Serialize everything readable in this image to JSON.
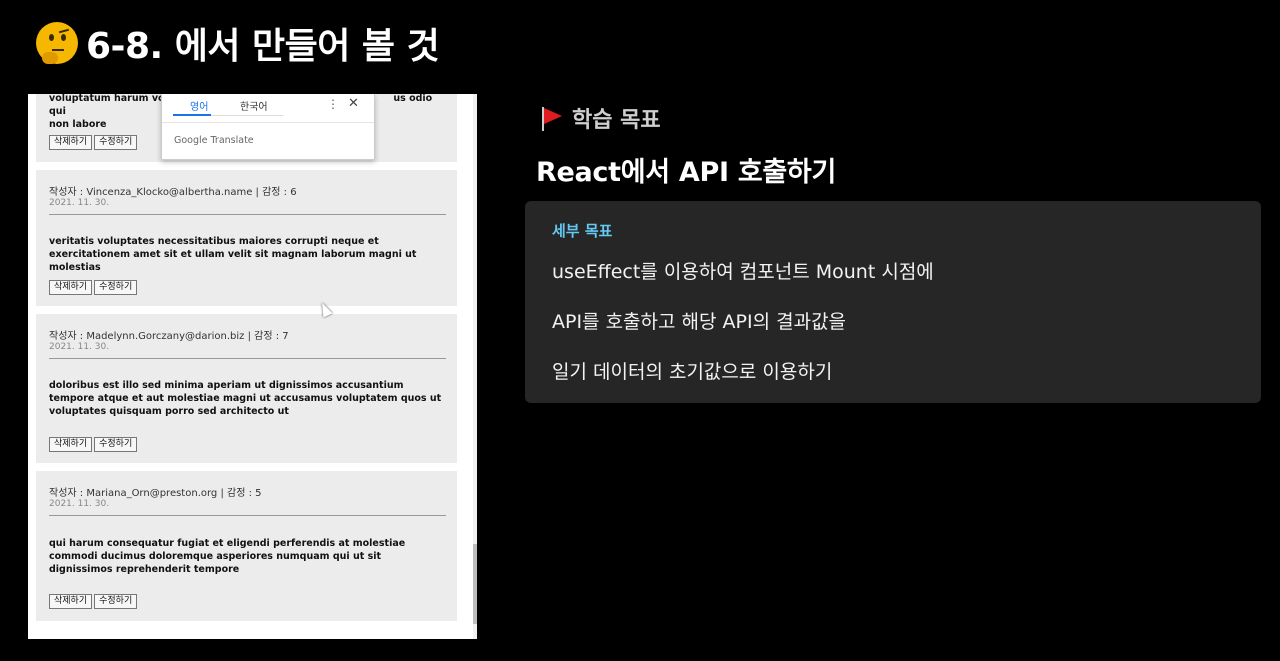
{
  "slide": {
    "title": "6-8. 에서 만들어 볼 것",
    "title_icon": "thinking-face-emoji"
  },
  "browser": {
    "top_entry": {
      "content_partial_1": "voluptatum harum volup",
      "content_partial_2": "us odio qui",
      "content_partial_3": "non labore",
      "delete_label": "삭제하기",
      "edit_label": "수정하기"
    },
    "translate_popup": {
      "tab_english": "영어",
      "tab_korean": "한국어",
      "more_icon": "⋮",
      "close_icon": "✕",
      "brand": "Google Translate"
    },
    "entries": [
      {
        "meta": "작성자 : Vincenza_Klocko@albertha.name | 감정 : 6",
        "date": "2021. 11. 30.",
        "content": "veritatis voluptates necessitatibus maiores corrupti neque et exercitationem amet sit et ullam velit sit magnam laborum magni ut molestias",
        "delete_label": "삭제하기",
        "edit_label": "수정하기"
      },
      {
        "meta": "작성자 : Madelynn.Gorczany@darion.biz | 감정 : 7",
        "date": "2021. 11. 30.",
        "content": "doloribus est illo sed minima aperiam ut dignissimos accusantium tempore atque et aut molestiae magni ut accusamus voluptatem quos ut voluptates quisquam porro sed architecto ut",
        "delete_label": "삭제하기",
        "edit_label": "수정하기"
      },
      {
        "meta": "작성자 : Mariana_Orn@preston.org | 감정 : 5",
        "date": "2021. 11. 30.",
        "content": "qui harum consequatur fugiat et eligendi perferendis at molestiae commodi ducimus doloremque asperiores numquam qui ut sit dignissimos reprehenderit tempore",
        "delete_label": "삭제하기",
        "edit_label": "수정하기"
      }
    ]
  },
  "goals": {
    "heading": "학습 목표",
    "main": "React에서 API 호출하기",
    "detail_title": "세부 목표",
    "details": [
      "useEffect를 이용하여 컴포넌트 Mount 시점에",
      "API를 호출하고 해당 API의 결과값을",
      "일기 데이터의 초기값으로 이용하기"
    ],
    "colors": {
      "accent": "#64c8f2",
      "flag": "#e01b22",
      "panel": "#262626"
    }
  }
}
